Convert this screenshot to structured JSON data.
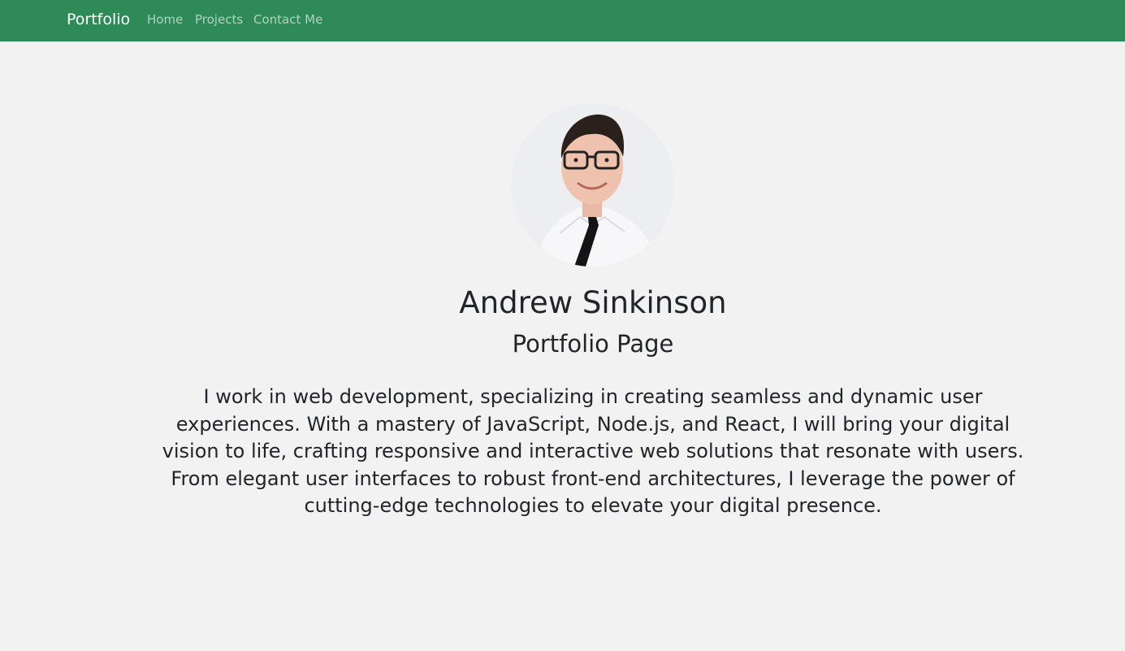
{
  "navbar": {
    "brand": "Portfolio",
    "links": [
      {
        "label": "Home"
      },
      {
        "label": "Projects"
      },
      {
        "label": "Contact Me"
      }
    ],
    "background": "#2e8b57"
  },
  "profile": {
    "name": "Andrew Sinkinson",
    "subtitle": "Portfolio Page",
    "bio": "I work in web development, specializing in creating seamless and dynamic user experiences. With a mastery of JavaScript, Node.js, and React, I will bring your digital vision to life, crafting responsive and interactive web solutions that resonate with users. From elegant user interfaces to robust front-end architectures, I leverage the power of cutting-edge technologies to elevate your digital presence."
  },
  "colors": {
    "page_background": "#f2f2f2",
    "text": "#212529"
  }
}
